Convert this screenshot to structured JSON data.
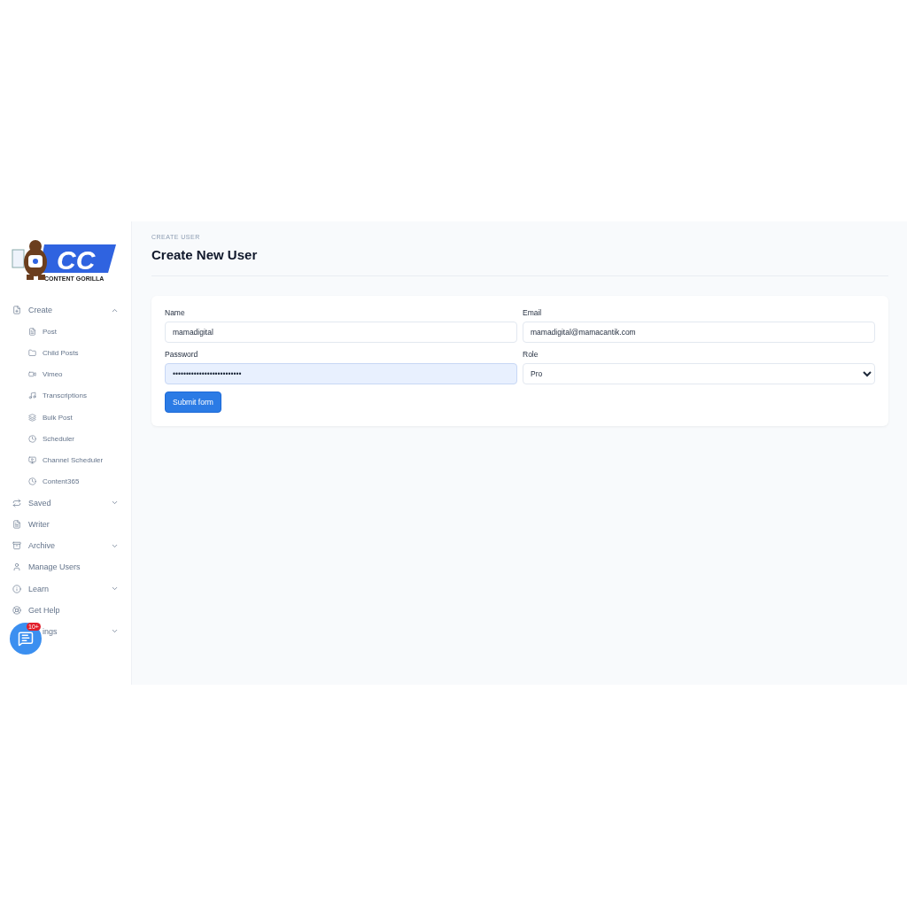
{
  "logo": {
    "mark": "CC",
    "name": "CONTENT GORILLA"
  },
  "sidebar": {
    "items": [
      {
        "label": "Create",
        "expanded": true,
        "children": [
          {
            "label": "Post"
          },
          {
            "label": "Child Posts"
          },
          {
            "label": "Vimeo"
          },
          {
            "label": "Transcriptions"
          },
          {
            "label": "Bulk Post"
          },
          {
            "label": "Scheduler"
          },
          {
            "label": "Channel Scheduler"
          },
          {
            "label": "Content365"
          }
        ]
      },
      {
        "label": "Saved",
        "expanded": false
      },
      {
        "label": "Writer"
      },
      {
        "label": "Archive",
        "expanded": false
      },
      {
        "label": "Manage Users"
      },
      {
        "label": "Learn",
        "expanded": false
      },
      {
        "label": "Get Help"
      },
      {
        "label": "ings",
        "expanded": false
      }
    ]
  },
  "chat": {
    "badge": "10+"
  },
  "page": {
    "eyebrow": "CREATE USER",
    "title": "Create New User"
  },
  "form": {
    "fields": [
      {
        "kind": "input",
        "label": "Name",
        "value": "mamadigital",
        "autofilled": false
      },
      {
        "kind": "input",
        "label": "Email",
        "value": "mamadigital@mamacantik.com",
        "autofilled": false
      },
      {
        "kind": "input",
        "label": "Password",
        "value": "••••••••••••••••••••••••••",
        "autofilled": true
      },
      {
        "kind": "select",
        "label": "Role",
        "value": "Pro",
        "autofilled": false
      }
    ],
    "submit": "Submit form"
  }
}
